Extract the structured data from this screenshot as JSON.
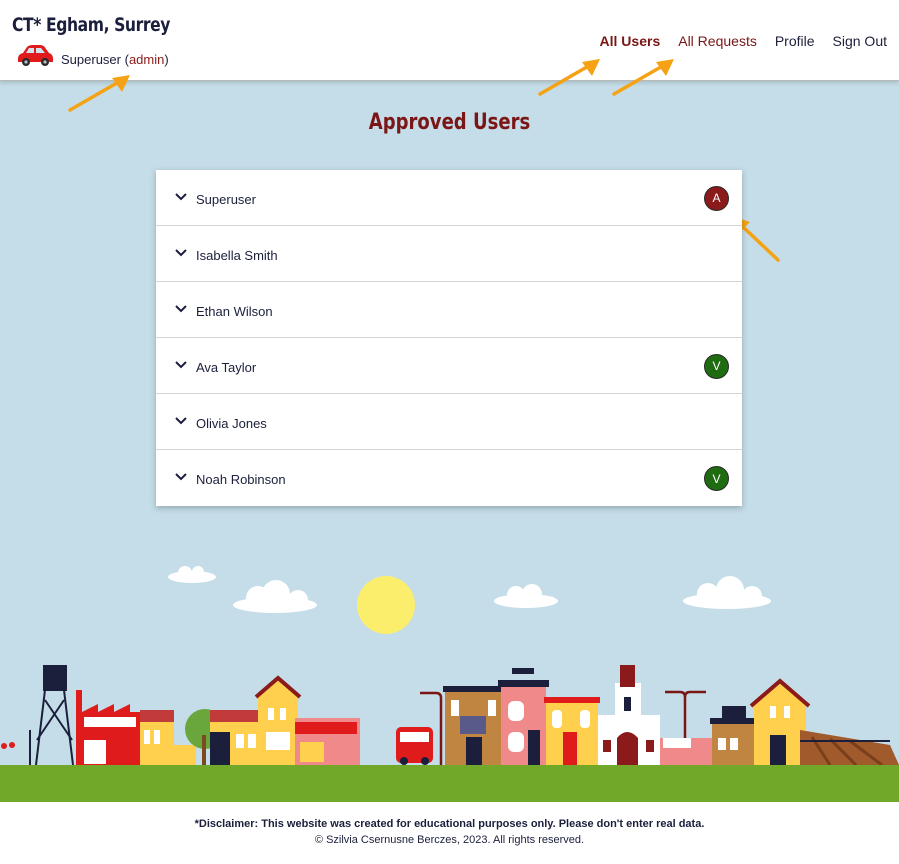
{
  "header": {
    "brand": "CT* Egham, Surrey",
    "user_name": "Superuser",
    "user_role": "admin",
    "nav": [
      {
        "label": "All Users"
      },
      {
        "label": "All Requests"
      },
      {
        "label": "Profile"
      },
      {
        "label": "Sign Out"
      }
    ]
  },
  "main": {
    "title": "Approved Users",
    "users": [
      {
        "name": "Superuser",
        "badge": "A",
        "badge_color": "#8b1a1a"
      },
      {
        "name": "Isabella Smith",
        "badge": ""
      },
      {
        "name": "Ethan Wilson",
        "badge": ""
      },
      {
        "name": "Ava Taylor",
        "badge": "V",
        "badge_color": "#1f6b12"
      },
      {
        "name": "Olivia Jones",
        "badge": ""
      },
      {
        "name": "Noah Robinson",
        "badge": "V",
        "badge_color": "#1f6b12"
      }
    ]
  },
  "footer": {
    "disclaimer": "*Disclaimer: This website was created for educational purposes only. Please don't enter real data.",
    "copyright": "© Szilvia Csernusne Berczes, 2023. All rights reserved."
  },
  "colors": {
    "accent": "#7a1616",
    "sky": "#c5dde8",
    "grass": "#71a82a",
    "arrow": "#f5a214"
  },
  "icons": [
    "car-icon",
    "chevron-down-icon",
    "arrow-icon"
  ]
}
